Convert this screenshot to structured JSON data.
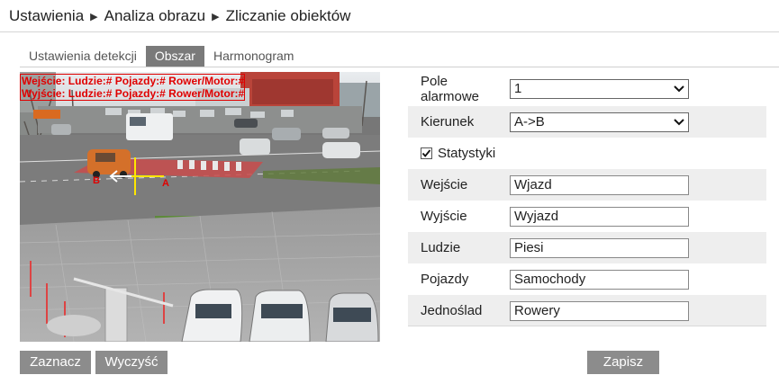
{
  "breadcrumb": {
    "items": [
      "Ustawienia",
      "Analiza obrazu",
      "Zliczanie obiektów"
    ],
    "separator": "▶"
  },
  "tabs": [
    {
      "label": "Ustawienia detekcji",
      "active": false
    },
    {
      "label": "Obszar",
      "active": true
    },
    {
      "label": "Harmonogram",
      "active": false
    }
  ],
  "camera": {
    "osd_line1": "Wejście: Ludzie:# Pojazdy:# Rower/Motor:#",
    "osd_line2": "Wyjście: Ludzie:# Pojazdy:# Rower/Motor:#",
    "point_a": "A",
    "point_b": "B",
    "osd_color": "#e00000",
    "line_color": "#ffe600"
  },
  "form": {
    "alarm_field_label": "Pole alarmowe",
    "alarm_field_value": "1",
    "direction_label": "Kierunek",
    "direction_value": "A->B",
    "statistics_label": "Statystyki",
    "statistics_checked": true,
    "entry_label": "Wejście",
    "entry_value": "Wjazd",
    "exit_label": "Wyjście",
    "exit_value": "Wyjazd",
    "people_label": "Ludzie",
    "people_value": "Piesi",
    "vehicles_label": "Pojazdy",
    "vehicles_value": "Samochody",
    "bikes_label": "Jednoślad",
    "bikes_value": "Rowery"
  },
  "buttons": {
    "mark": "Zaznacz",
    "clear": "Wyczyść",
    "save": "Zapisz"
  }
}
